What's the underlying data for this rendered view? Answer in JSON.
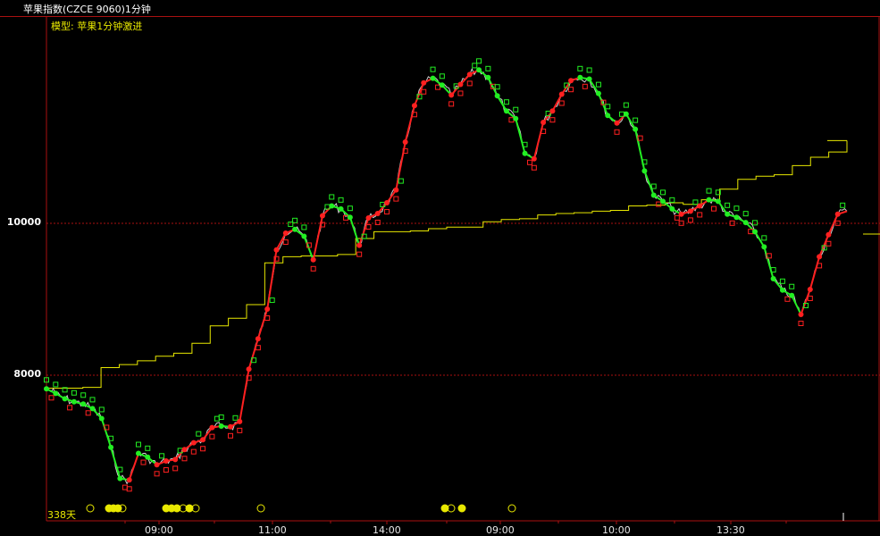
{
  "header": {
    "title": "苹果指数(CZCE 9060)1分钟",
    "model_label": "模型: 苹果1分钟激进"
  },
  "counter": {
    "days": "338天"
  },
  "colors": {
    "background": "#000000",
    "frame": "#aa1111",
    "rise": "#ff2020",
    "fall": "#22ee22",
    "avg_line": "#e8e800",
    "price_line": "#d0d0d0"
  },
  "chart_data": {
    "type": "line",
    "y_ticks": [
      {
        "value": 10000,
        "label": "10000"
      },
      {
        "value": 8000,
        "label": "8000"
      }
    ],
    "x_ticks": [
      "09:00",
      "11:00",
      "14:00",
      "09:00",
      "10:00",
      "13:30"
    ],
    "series": [
      {
        "values": [
          7820,
          7760,
          7690,
          7650,
          7620,
          7560,
          7430,
          7050,
          6640,
          6620,
          6970,
          6920,
          6820,
          6870,
          6890,
          7020,
          7110,
          7150,
          7310,
          7330,
          7320,
          7390,
          8080,
          8480,
          8870,
          9650,
          9870,
          9920,
          9830,
          9520,
          10100,
          10230,
          10190,
          10080,
          9710,
          10070,
          10130,
          10270,
          10440,
          11070,
          11550,
          11850,
          11910,
          11820,
          11690,
          11830,
          11960,
          12020,
          11920,
          11680,
          11480,
          11380,
          10920,
          10850,
          11330,
          11480,
          11700,
          11880,
          11920,
          11900,
          11710,
          11420,
          11320,
          11440,
          11240,
          10690,
          10370,
          10290,
          10190,
          10120,
          10160,
          10230,
          10310,
          10290,
          10120,
          10080,
          10010,
          9890,
          9690,
          9270,
          9120,
          9050,
          8800,
          9130,
          9560,
          9850,
          10120,
          10160
        ]
      },
      {
        "values": [
          7830,
          7830,
          7840,
          8100,
          8140,
          8190,
          8250,
          8290,
          8420,
          8650,
          8750,
          8930,
          9480,
          9560,
          9570,
          9570,
          9590,
          9800,
          9890,
          9890,
          9900,
          9930,
          9950,
          9950,
          10020,
          10050,
          10060,
          10110,
          10130,
          10140,
          10160,
          10170,
          10230,
          10240,
          10270,
          10250,
          10310,
          10450,
          10580,
          10620,
          10640,
          10760,
          10870,
          10940,
          11090
        ]
      }
    ]
  }
}
